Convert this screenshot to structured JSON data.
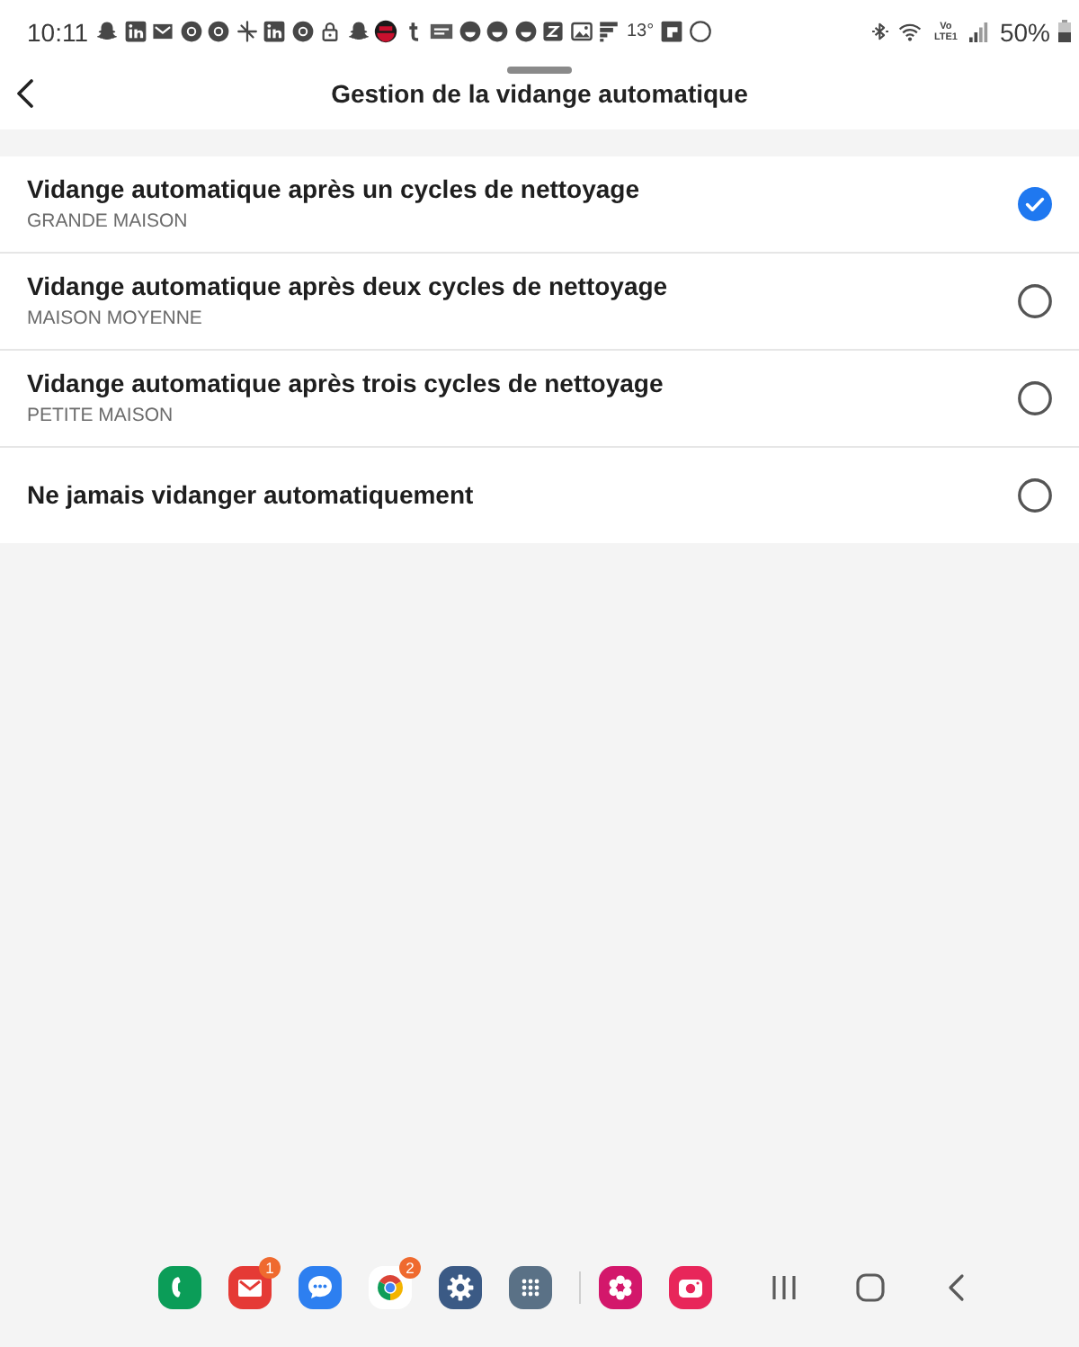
{
  "status_bar": {
    "time": "10:11",
    "temperature": "13°",
    "network_label": "Vo LTE1",
    "battery": "50%"
  },
  "header": {
    "title": "Gestion de la vidange automatique"
  },
  "options": [
    {
      "title": "Vidange automatique après un cycles de nettoyage",
      "subtitle": "GRANDE MAISON",
      "selected": true
    },
    {
      "title": "Vidange automatique après deux cycles de nettoyage",
      "subtitle": "MAISON MOYENNE",
      "selected": false
    },
    {
      "title": "Vidange automatique après trois cycles de nettoyage",
      "subtitle": "PETITE MAISON",
      "selected": false
    },
    {
      "title": "Ne jamais vidanger automatiquement",
      "selected": false
    }
  ],
  "dock": {
    "apps": [
      {
        "kind": "phone"
      },
      {
        "kind": "email",
        "badge": "1"
      },
      {
        "kind": "messages"
      },
      {
        "kind": "browser",
        "badge": "2"
      },
      {
        "kind": "settings"
      },
      {
        "kind": "apps"
      }
    ],
    "pinned": [
      {
        "kind": "gallery"
      },
      {
        "kind": "camera"
      }
    ]
  }
}
